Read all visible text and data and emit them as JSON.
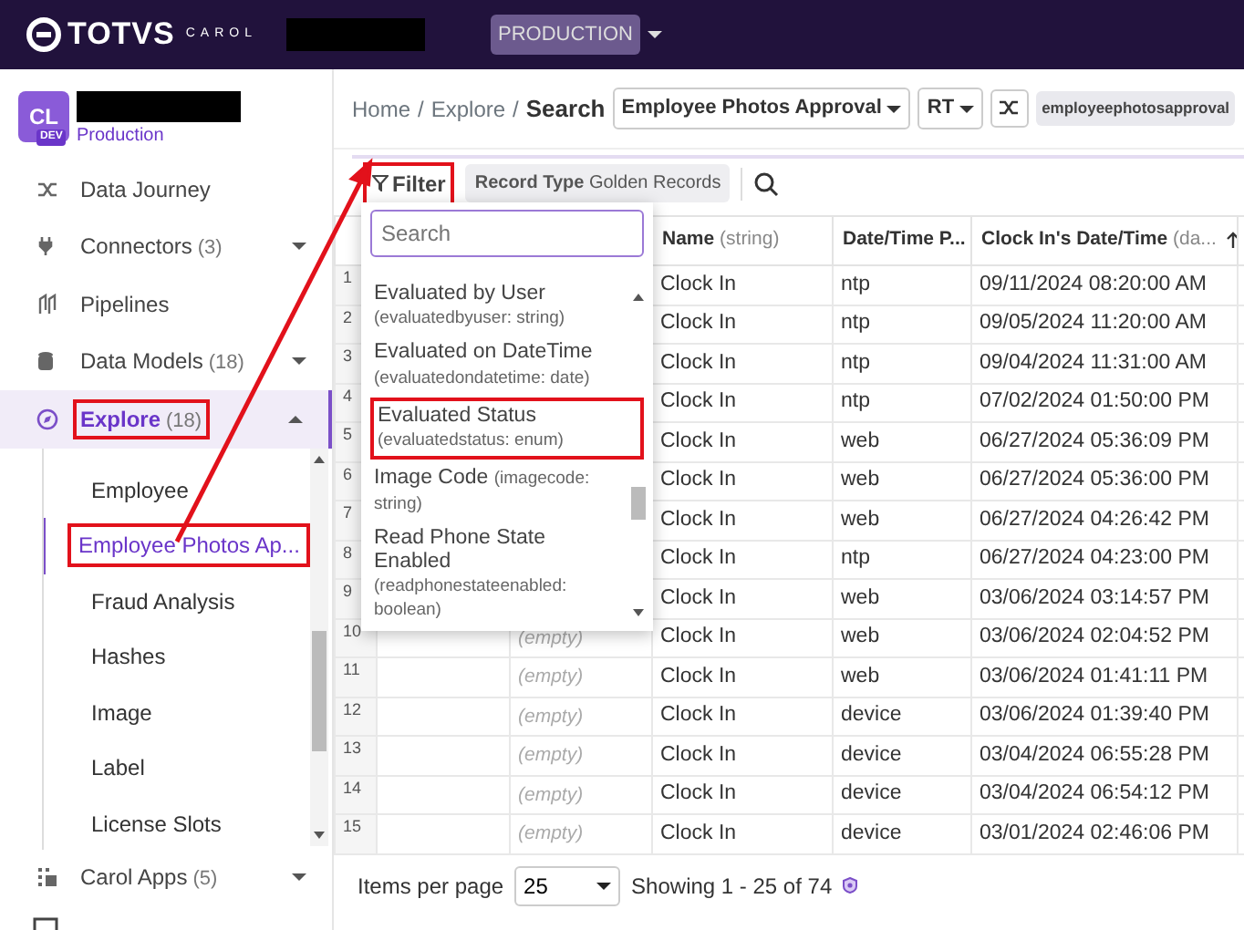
{
  "topbar": {
    "logo": "TOTVS",
    "logo_sub": "CAROL",
    "environment": "PRODUCTION"
  },
  "sidebar": {
    "tile": "CL",
    "tile_badge": "DEV",
    "environment": "Production",
    "items": [
      {
        "label": "Data Journey",
        "selected": false
      },
      {
        "label": "Connectors",
        "count": "(3)",
        "expanded": false,
        "selected": false
      },
      {
        "label": "Pipelines",
        "selected": false
      },
      {
        "label": "Data Models",
        "count": "(18)",
        "expanded": false,
        "selected": false
      },
      {
        "label": "Explore",
        "count": "(18)",
        "expanded": true,
        "selected": true,
        "highlighted": true,
        "children": [
          {
            "label": "Employee",
            "selected": false,
            "highlighted": false
          },
          {
            "label": "Employee Photos Ap...",
            "selected": true,
            "highlighted": true
          },
          {
            "label": "Fraud Analysis",
            "selected": false,
            "highlighted": false
          },
          {
            "label": "Hashes",
            "selected": false,
            "highlighted": false
          },
          {
            "label": "Image",
            "selected": false,
            "highlighted": false
          },
          {
            "label": "Label",
            "selected": false,
            "highlighted": false
          },
          {
            "label": "License Slots",
            "selected": false,
            "highlighted": false
          }
        ]
      },
      {
        "label": "Carol Apps",
        "count": "(5)",
        "expanded": false,
        "selected": false
      }
    ]
  },
  "breadcrumb": {
    "items": [
      "Home",
      "Explore"
    ],
    "separator": "/",
    "current": "Search",
    "entity": "Employee Photos Approval",
    "mode": "RT",
    "tag": "employeephotosapproval"
  },
  "toolbar": {
    "filter": {
      "label": "Filter",
      "highlighted": true
    },
    "chip": {
      "label": "Record Type",
      "value": "Golden Records"
    }
  },
  "filter_menu": {
    "placeholder": "Search",
    "options": [
      {
        "label": "Evaluated by User",
        "field": "(evaluatedbyuser: string)",
        "highlighted": false
      },
      {
        "label": "Evaluated on DateTime",
        "field": "(evaluatedondatetime: date)",
        "highlighted": false
      },
      {
        "label": "Evaluated Status",
        "field": "(evaluatedstatus: enum)",
        "highlighted": true
      },
      {
        "label": "Image Code",
        "field": "(imagecode: string)",
        "highlighted": false
      },
      {
        "label": "Read Phone State Enabled",
        "field": "(readphonestateenabled: boolean)",
        "highlighted": false
      }
    ]
  },
  "table": {
    "columns": [
      {
        "label": "Name",
        "type": "(string)",
        "sorted": false
      },
      {
        "label": "Date/Time P...",
        "sorted": false
      },
      {
        "label": "Clock In's Date/Time",
        "type": "(da...",
        "sorted": true
      }
    ],
    "rows": [
      {
        "number": "1",
        "name": "Clock In",
        "source": "ntp",
        "datetime": "09/11/2024 08:20:00 AM"
      },
      {
        "number": "2",
        "name": "Clock In",
        "source": "ntp",
        "datetime": "09/05/2024 11:20:00 AM"
      },
      {
        "number": "3",
        "name": "Clock In",
        "source": "ntp",
        "datetime": "09/04/2024 11:31:00 AM"
      },
      {
        "number": "4",
        "name": "Clock In",
        "source": "ntp",
        "datetime": "07/02/2024 01:50:00 PM"
      },
      {
        "number": "5",
        "name": "Clock In",
        "source": "web",
        "datetime": "06/27/2024 05:36:09 PM"
      },
      {
        "number": "6",
        "name": "Clock In",
        "source": "web",
        "datetime": "06/27/2024 05:36:00 PM"
      },
      {
        "number": "7",
        "name": "Clock In",
        "source": "web",
        "datetime": "06/27/2024 04:26:42 PM"
      },
      {
        "number": "8",
        "name": "Clock In",
        "source": "ntp",
        "datetime": "06/27/2024 04:23:00 PM"
      },
      {
        "number": "9",
        "name": "Clock In",
        "source": "web",
        "datetime": "03/06/2024 03:14:57 PM"
      },
      {
        "number": "10",
        "column_3": "(empty)",
        "name": "Clock In",
        "source": "web",
        "datetime": "03/06/2024 02:04:52 PM"
      },
      {
        "number": "11",
        "column_3": "(empty)",
        "name": "Clock In",
        "source": "web",
        "datetime": "03/06/2024 01:41:11 PM"
      },
      {
        "number": "12",
        "column_3": "(empty)",
        "name": "Clock In",
        "source": "device",
        "datetime": "03/06/2024 01:39:40 PM"
      },
      {
        "number": "13",
        "column_3": "(empty)",
        "name": "Clock In",
        "source": "device",
        "datetime": "03/04/2024 06:55:28 PM"
      },
      {
        "number": "14",
        "column_3": "(empty)",
        "name": "Clock In",
        "source": "device",
        "datetime": "03/04/2024 06:54:12 PM"
      },
      {
        "number": "15",
        "column_3": "(empty)",
        "name": "Clock In",
        "source": "device",
        "datetime": "03/01/2024 02:46:06 PM"
      }
    ]
  },
  "pagination": {
    "label": "Items per page",
    "per_page": "25",
    "summary": "Showing 1 - 25 of 74"
  },
  "annotation": {
    "arrow": true
  }
}
